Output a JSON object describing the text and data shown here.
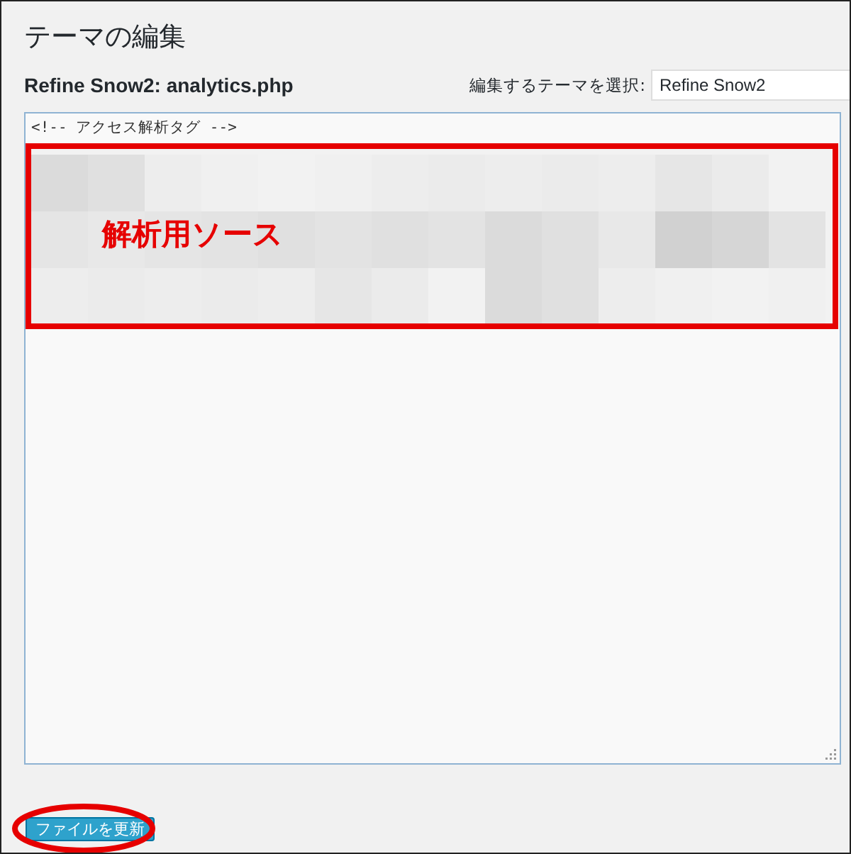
{
  "page_title": "テーマの編集",
  "file_heading": "Refine Snow2: analytics.php",
  "theme_select": {
    "label": "編集するテーマを選択:",
    "value": "Refine Snow2"
  },
  "editor": {
    "code_lines": [
      "<!-- アクセス解析タグ -->"
    ],
    "redacted_block": {
      "kind": "picture"
    }
  },
  "annotations": [
    {
      "kind": "box",
      "label": "解析用ソース"
    },
    {
      "kind": "ellipse"
    }
  ],
  "update_button": "ファイルを更新"
}
